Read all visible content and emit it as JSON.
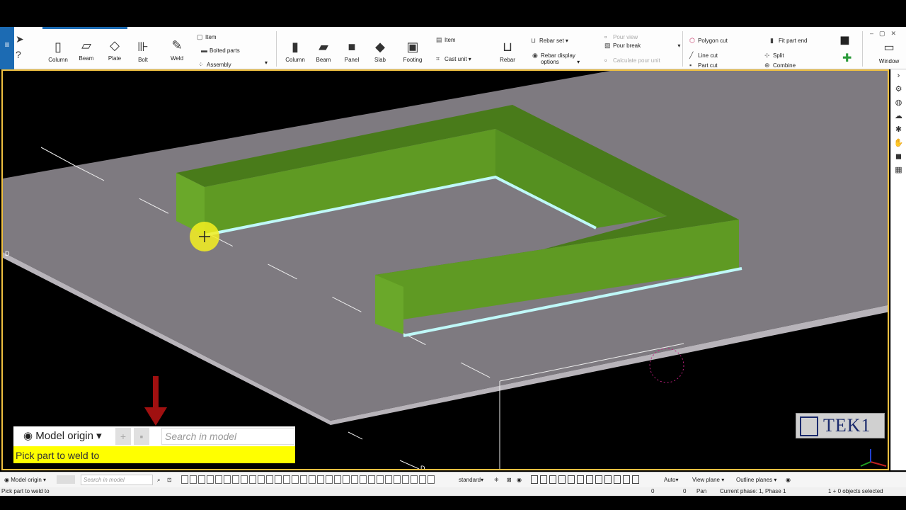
{
  "ribbon": {
    "menu_icon": "≡",
    "steel": {
      "column": "Column",
      "beam": "Beam",
      "plate": "Plate",
      "bolt": "Bolt",
      "weld": "Weld",
      "item": "Item",
      "bolted_parts": "Bolted parts",
      "assembly": "Assembly"
    },
    "concrete": {
      "column": "Column",
      "beam": "Beam",
      "panel": "Panel",
      "slab": "Slab",
      "footing": "Footing",
      "item": "Item",
      "cast_unit": "Cast unit",
      "rebar": "Rebar",
      "rebar_set": "Rebar set",
      "rebar_display_options_1": "Rebar display",
      "rebar_display_options_2": "options",
      "pour_view": "Pour view",
      "pour_break": "Pour break",
      "calculate_pour_unit": "Calculate pour unit"
    },
    "edit": {
      "polygon_cut": "Polygon cut",
      "line_cut": "Line cut",
      "part_cut": "Part cut",
      "fit_part_end": "Fit part end",
      "split": "Split",
      "combine": "Combine"
    },
    "window": "Window"
  },
  "floating_search": {
    "origin": "Model origin",
    "placeholder": "Search in model",
    "prompt": "Pick part to weld to"
  },
  "watermark": "TEK1",
  "viewport_labels": {
    "d1": "D",
    "d2": "D"
  },
  "statusbar": {
    "origin": "Model origin",
    "search_placeholder": "Search in model",
    "snap_mode": "standard",
    "auto": "Auto",
    "view_plane": "View plane",
    "outline_planes": "Outline planes"
  },
  "bottom": {
    "prompt": "Pick part to weld to",
    "coord_x": "0",
    "coord_y": "0",
    "mode": "Pan",
    "phase": "Current phase: 1, Phase 1",
    "selection": "1 + 0 objects selected"
  },
  "colors": {
    "accent": "#1c6bb3",
    "highlight_border": "#f0c040",
    "part_green": "#5f9a23",
    "slab_gray": "#7e7a80",
    "prompt_yellow": "#ffff00"
  }
}
